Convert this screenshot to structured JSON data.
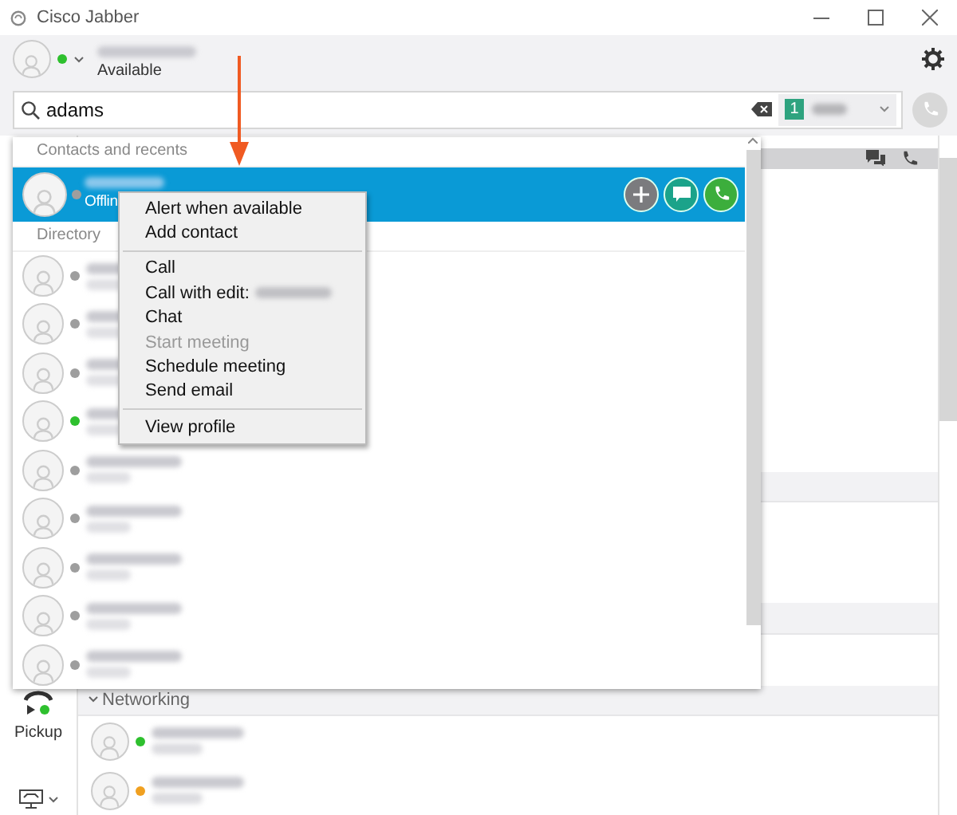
{
  "window": {
    "title": "Cisco Jabber"
  },
  "profile": {
    "status_text": "Available"
  },
  "search": {
    "value": "adams",
    "line_badge": "1"
  },
  "popup": {
    "section_recents": "Contacts and recents",
    "selected_contact": {
      "status": "Offlin",
      "color": "#9e9e9e",
      "selected": true
    },
    "section_directory": "Directory",
    "contacts": [
      {
        "color": "#9e9e9e"
      },
      {
        "color": "#9e9e9e"
      },
      {
        "color": "#9e9e9e"
      },
      {
        "color": "#2ec02e"
      },
      {
        "color": "#9e9e9e"
      },
      {
        "color": "#9e9e9e"
      },
      {
        "color": "#9e9e9e"
      },
      {
        "color": "#9e9e9e"
      },
      {
        "color": "#9e9e9e"
      }
    ]
  },
  "context_menu": {
    "groups": [
      [
        {
          "label": "Alert when available",
          "disabled": false,
          "redacted": false
        },
        {
          "label": "Add contact",
          "disabled": false,
          "redacted": false
        }
      ],
      [
        {
          "label": "Call",
          "disabled": false,
          "redacted": false
        },
        {
          "label": "Call with edit:",
          "disabled": false,
          "redacted": true
        },
        {
          "label": "Chat",
          "disabled": false,
          "redacted": false
        },
        {
          "label": "Start meeting",
          "disabled": true,
          "redacted": false
        },
        {
          "label": "Schedule meeting",
          "disabled": false,
          "redacted": false
        },
        {
          "label": "Send email",
          "disabled": false,
          "redacted": false
        }
      ],
      [
        {
          "label": "View profile",
          "disabled": false,
          "redacted": false
        }
      ]
    ]
  },
  "group": {
    "label": "Networking",
    "expanded": true,
    "contacts": [
      {
        "color": "#2ec02e"
      },
      {
        "color": "#f0a020"
      }
    ]
  },
  "sidebar": {
    "pickup_label": "Pickup"
  }
}
